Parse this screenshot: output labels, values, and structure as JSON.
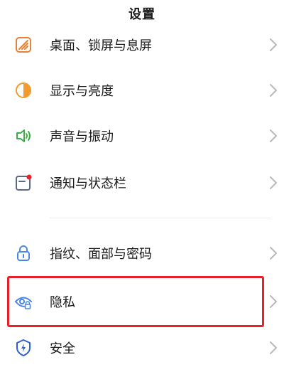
{
  "header": {
    "title": "设置"
  },
  "items": [
    {
      "label": "桌面、锁屏与息屏",
      "icon": "wallpaper-icon",
      "icon_color": "#e8823a"
    },
    {
      "label": "显示与亮度",
      "icon": "brightness-icon",
      "icon_color": "#f29a2e"
    },
    {
      "label": "声音与振动",
      "icon": "speaker-icon",
      "icon_color": "#3fae4a"
    },
    {
      "label": "通知与状态栏",
      "icon": "notification-icon",
      "icon_color": "#5a6a86"
    },
    {
      "label": "指纹、面部与密码",
      "icon": "lock-icon",
      "icon_color": "#4a86e8"
    },
    {
      "label": "隐私",
      "icon": "privacy-eye-icon",
      "icon_color": "#4a86e8"
    },
    {
      "label": "安全",
      "icon": "shield-icon",
      "icon_color": "#2f5fd0"
    }
  ],
  "colors": {
    "highlight": "#e8202a",
    "chevron": "#b8b8b8",
    "text": "#1a1a1a"
  }
}
